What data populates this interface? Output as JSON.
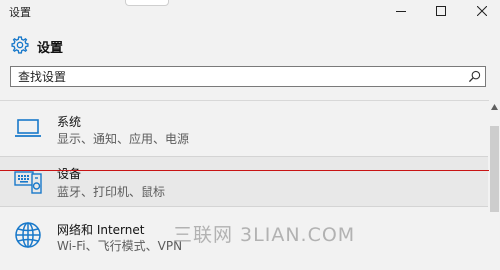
{
  "window": {
    "title": "设置",
    "controls": [
      "minimize-icon",
      "maximize-icon",
      "close-icon"
    ]
  },
  "header": {
    "icon": "gear-icon",
    "title": "设置"
  },
  "search": {
    "placeholder": "查找设置",
    "value": "",
    "icon": "search-icon"
  },
  "items": [
    {
      "icon": "laptop-icon",
      "title": "系统",
      "subtitle": "显示、通知、应用、电源"
    },
    {
      "icon": "devices-icon",
      "title": "设备",
      "subtitle": "蓝牙、打印机、鼠标"
    },
    {
      "icon": "globe-icon",
      "title": "网络和 Internet",
      "subtitle": "Wi-Fi、飞行模式、VPN"
    }
  ],
  "watermark": "三联网 3LIAN.COM",
  "colors": {
    "accent": "#1979ca",
    "background": "#f2f2f2",
    "highlight": "#e8e8e8",
    "annotation_line": "#c81414",
    "watermark": "#b2b2b2"
  }
}
